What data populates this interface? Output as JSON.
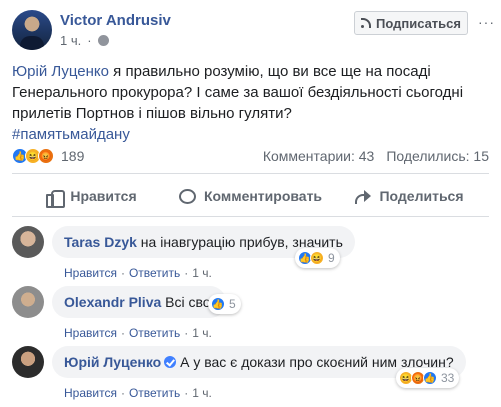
{
  "post": {
    "author": "Victor Andrusiv",
    "time": "1 ч.",
    "subscribe_label": "Подписаться",
    "more_label": "···",
    "mention": "Юрій Луценко",
    "text_line1_rest": " я правильно розумію, що ви все ще на посаді",
    "text_line2": "Генерального прокурора? І саме за вашої бездіяльності сьогодні",
    "text_line3": "прилетів Портнов і пішов вільно гуляти?",
    "hashtag": "#памятьмайдану",
    "reactions_count": "189",
    "reaction_icons": [
      "like",
      "haha",
      "angry"
    ],
    "comments_count": "Комментарии: 43",
    "shares_count": "Поделились: 15"
  },
  "actions": {
    "like_label": "Нравится",
    "comment_label": "Комментировать",
    "share_label": "Поделиться"
  },
  "comments": [
    {
      "name": "Taras Dzyk",
      "text": "на інавгурацію прибув, значить",
      "reactions": [
        "like",
        "haha"
      ],
      "count": "9",
      "like_label": "Нравится",
      "reply_label": "Ответить",
      "time": "1 ч."
    },
    {
      "name": "Olexandr Pliva",
      "text": "Всі свої",
      "reactions": [
        "like"
      ],
      "count": "5",
      "like_label": "Нравится",
      "reply_label": "Ответить",
      "time": "1 ч."
    },
    {
      "name": "Юрій Луценко",
      "verified": true,
      "text": "А у вас є докази про скоєний ним злочин?",
      "reactions": [
        "haha",
        "angry",
        "like"
      ],
      "count": "33",
      "like_label": "Нравится",
      "reply_label": "Ответить",
      "time": "1 ч."
    }
  ],
  "colors": {
    "link": "#385898",
    "muted": "#606770",
    "bubble": "#f2f3f5",
    "like": "#2078f4",
    "haha": "#f7b125",
    "angry": "#e9710f"
  }
}
